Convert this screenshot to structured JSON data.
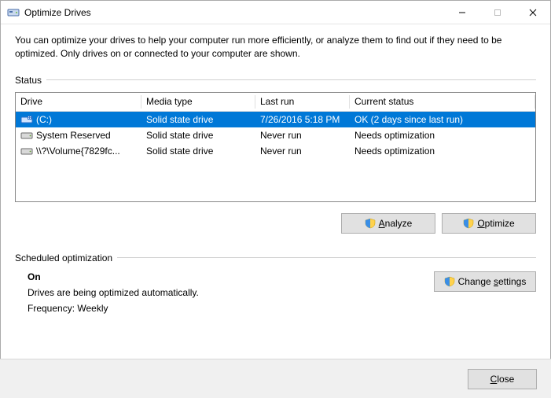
{
  "window": {
    "title": "Optimize Drives"
  },
  "description": "You can optimize your drives to help your computer run more efficiently, or analyze them to find out if they need to be optimized. Only drives on or connected to your computer are shown.",
  "status_label": "Status",
  "columns": {
    "drive": "Drive",
    "media": "Media type",
    "last": "Last run",
    "status": "Current status"
  },
  "drives": [
    {
      "name": "(C:)",
      "media": "Solid state drive",
      "last": "7/26/2016 5:18 PM",
      "status": "OK (2 days since last run)",
      "selected": true,
      "icon": "drive-os"
    },
    {
      "name": "System Reserved",
      "media": "Solid state drive",
      "last": "Never run",
      "status": "Needs optimization",
      "selected": false,
      "icon": "drive"
    },
    {
      "name": "\\\\?\\Volume{7829fc...",
      "media": "Solid state drive",
      "last": "Never run",
      "status": "Needs optimization",
      "selected": false,
      "icon": "drive"
    }
  ],
  "buttons": {
    "analyze_prefix": "",
    "analyze_u": "A",
    "analyze_rest": "nalyze",
    "optimize_prefix": "",
    "optimize_u": "O",
    "optimize_rest": "ptimize",
    "change_prefix": "Change ",
    "change_u": "s",
    "change_rest": "ettings",
    "close_u": "C",
    "close_rest": "lose"
  },
  "sched": {
    "label": "Scheduled optimization",
    "on": "On",
    "line1": "Drives are being optimized automatically.",
    "line2": "Frequency: Weekly"
  }
}
